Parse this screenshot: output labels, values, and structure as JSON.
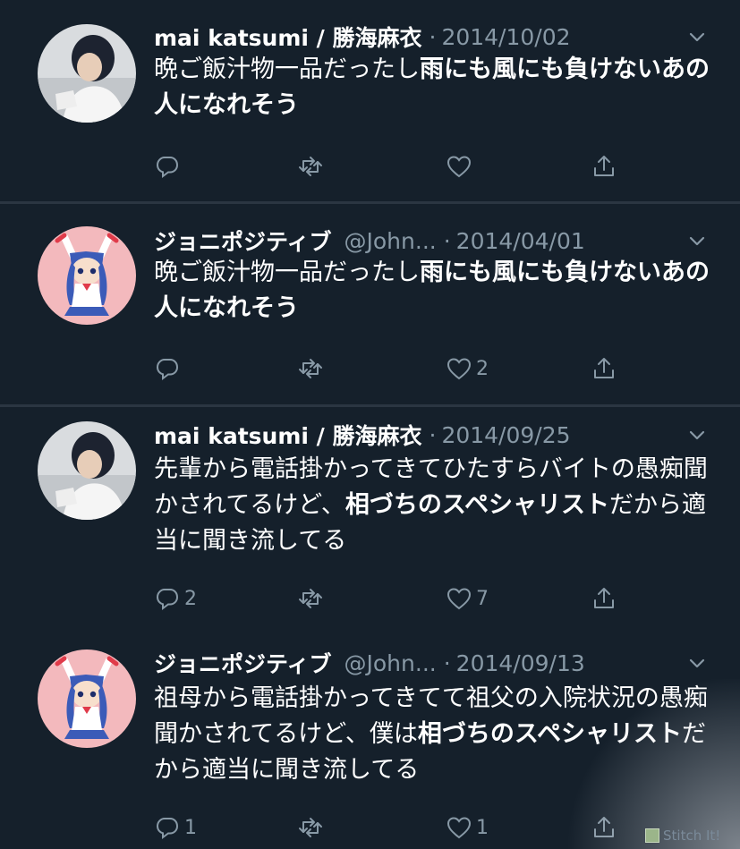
{
  "tweets": [
    {
      "name": "mai katsumi / 勝海麻衣",
      "handle": "",
      "separator": "·",
      "date": "2014/10/02",
      "text_normal_1": "晩ご飯汁物一品だったし",
      "text_bold_1": "雨にも風にも負けないあの人になれそう",
      "text_normal_2": "",
      "text_bold_2": "",
      "text_normal_3": "",
      "reply_count": "",
      "retweet_count": "",
      "like_count": "",
      "avatar_icon": "person-photo-avatar"
    },
    {
      "name": "ジョニポジティブ",
      "handle": "@John...",
      "separator": "·",
      "date": "2014/04/01",
      "text_normal_1": "晩ご飯汁物一品だったし",
      "text_bold_1": "雨にも風にも負けないあの人になれそう",
      "text_normal_2": "",
      "text_bold_2": "",
      "text_normal_3": "",
      "reply_count": "",
      "retweet_count": "",
      "like_count": "2",
      "avatar_icon": "anime-girl-avatar"
    },
    {
      "name": "mai katsumi / 勝海麻衣",
      "handle": "",
      "separator": "·",
      "date": "2014/09/25",
      "text_normal_1": "先輩から電話掛かってきてひたすらバイトの愚痴聞かされてるけど、",
      "text_bold_1": "相づちのスペシャリスト",
      "text_normal_2": "だから適当に聞き流してる",
      "text_bold_2": "",
      "text_normal_3": "",
      "reply_count": "2",
      "retweet_count": "",
      "like_count": "7",
      "avatar_icon": "person-photo-avatar"
    },
    {
      "name": "ジョニポジティブ",
      "handle": "@John...",
      "separator": "·",
      "date": "2014/09/13",
      "text_normal_1": "祖母から電話掛かってきてて祖父の入院状況の愚痴聞かされてるけど、僕は",
      "text_bold_1": "相づちのスペシャリスト",
      "text_normal_2": "だから適当に聞き流してる",
      "text_bold_2": "",
      "text_normal_3": "",
      "reply_count": "1",
      "retweet_count": "",
      "like_count": "1",
      "avatar_icon": "anime-girl-avatar"
    }
  ],
  "icons": {
    "reply": "reply-icon",
    "retweet": "retweet-icon",
    "like": "heart-icon",
    "share": "share-icon",
    "menu": "chevron-down-icon"
  },
  "watermark": {
    "text": "Stitch It!"
  },
  "colors": {
    "background": "#15202b",
    "text": "#ffffff",
    "muted": "#8899a6",
    "divider": "#2b3642"
  }
}
